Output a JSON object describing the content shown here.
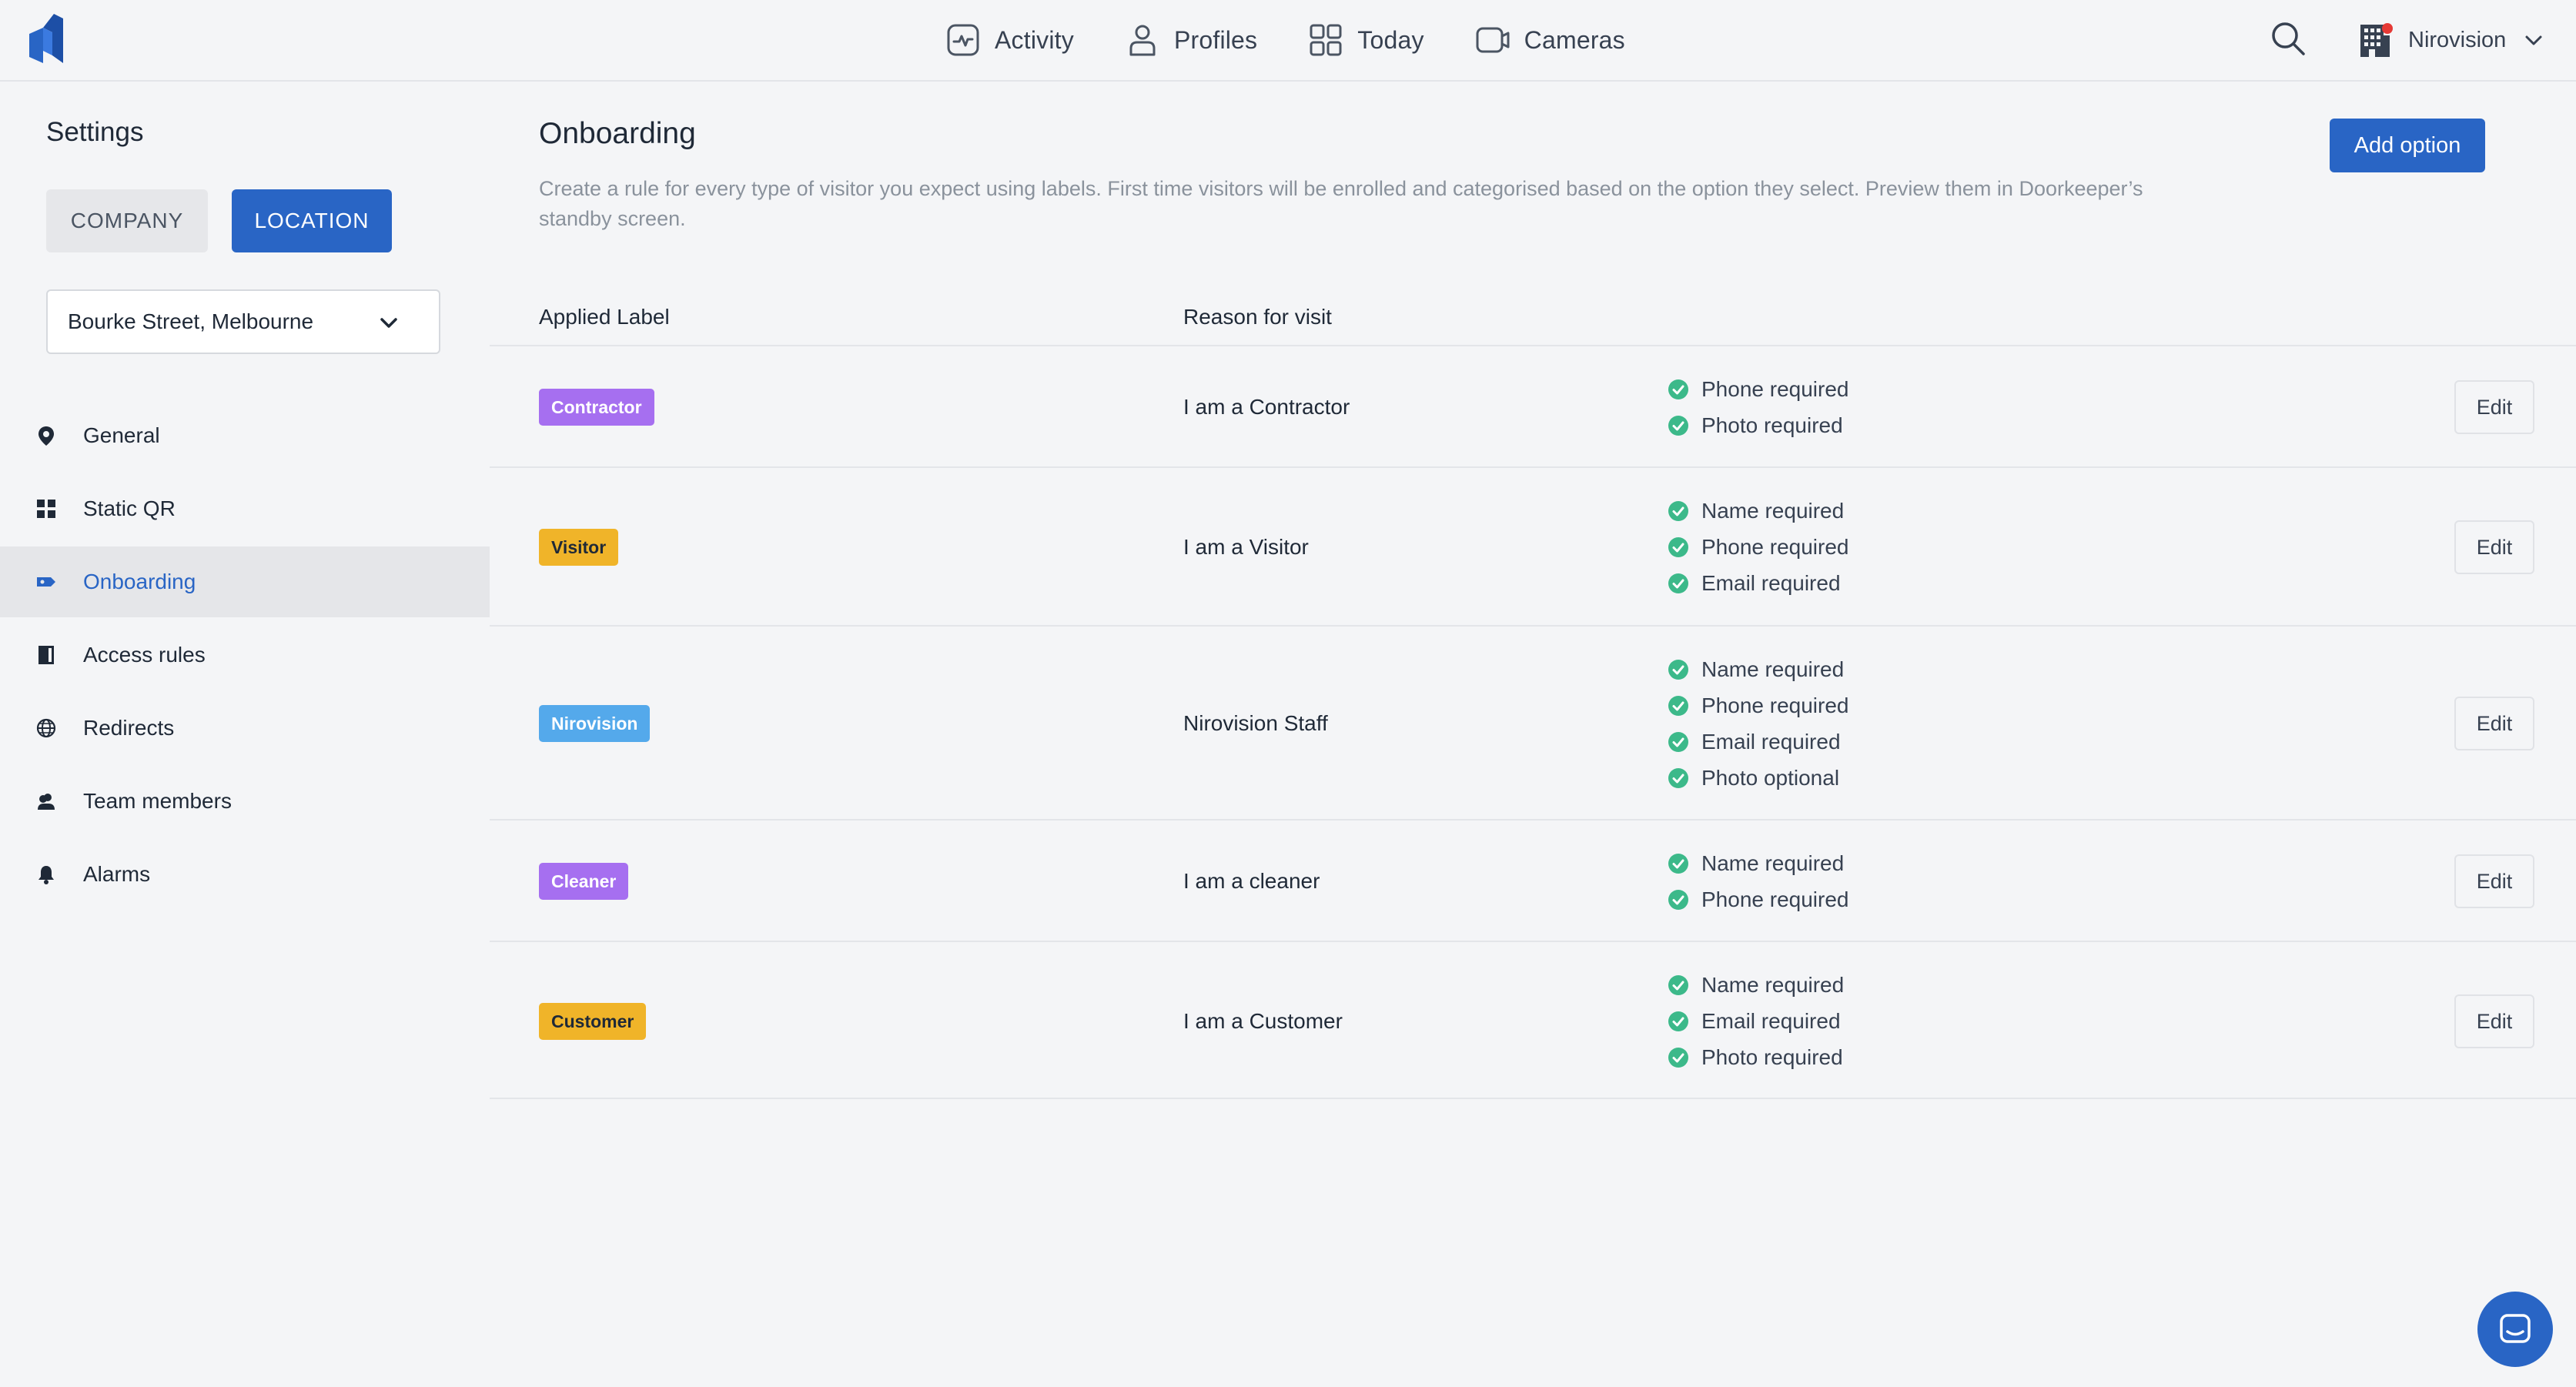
{
  "nav": {
    "items": [
      {
        "label": "Activity",
        "icon": "activity-icon"
      },
      {
        "label": "Profiles",
        "icon": "person-icon"
      },
      {
        "label": "Today",
        "icon": "grid-icon"
      },
      {
        "label": "Cameras",
        "icon": "camera-icon"
      }
    ],
    "org_name": "Nirovision"
  },
  "sidebar": {
    "title": "Settings",
    "scope_company": "COMPANY",
    "scope_location": "LOCATION",
    "location_selected": "Bourke Street, Melbourne",
    "items": [
      {
        "label": "General",
        "icon": "pin-icon"
      },
      {
        "label": "Static QR",
        "icon": "qr-icon"
      },
      {
        "label": "Onboarding",
        "icon": "tag-icon",
        "active": true
      },
      {
        "label": "Access rules",
        "icon": "door-icon"
      },
      {
        "label": "Redirects",
        "icon": "globe-icon"
      },
      {
        "label": "Team members",
        "icon": "team-icon"
      },
      {
        "label": "Alarms",
        "icon": "bell-icon"
      }
    ]
  },
  "main": {
    "title": "Onboarding",
    "add_button": "Add option",
    "description": "Create a rule for every type of visitor you expect using labels. First time visitors will be enrolled and categorised based on the option they select. Preview them in Doorkeeper’s standby screen.",
    "columns": {
      "label": "Applied Label",
      "reason": "Reason for visit"
    },
    "rows": [
      {
        "label": "Contractor",
        "label_color": "#a66ff0",
        "label_text_color": "#ffffff",
        "reason": "I am a Contractor",
        "requirements": [
          "Phone required",
          "Photo required"
        ],
        "edit": "Edit"
      },
      {
        "label": "Visitor",
        "label_color": "#f0b429",
        "label_text_color": "#1f2937",
        "reason": "I am a Visitor",
        "requirements": [
          "Name required",
          "Phone required",
          "Email required"
        ],
        "edit": "Edit"
      },
      {
        "label": "Nirovision",
        "label_color": "#54a9eb",
        "label_text_color": "#ffffff",
        "reason": "Nirovision Staff",
        "requirements": [
          "Name required",
          "Phone required",
          "Email required",
          "Photo optional"
        ],
        "edit": "Edit"
      },
      {
        "label": "Cleaner",
        "label_color": "#a66ff0",
        "label_text_color": "#ffffff",
        "reason": "I am a cleaner",
        "requirements": [
          "Name required",
          "Phone required"
        ],
        "edit": "Edit"
      },
      {
        "label": "Customer",
        "label_color": "#f0b429",
        "label_text_color": "#1f2937",
        "reason": "I am a Customer",
        "requirements": [
          "Name required",
          "Email required",
          "Photo required"
        ],
        "edit": "Edit"
      }
    ]
  },
  "colors": {
    "accent": "#2965c5",
    "check": "#3cb98a"
  }
}
